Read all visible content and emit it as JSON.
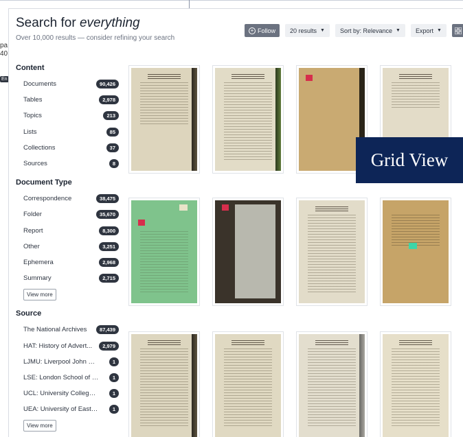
{
  "background": {
    "frag1": "pa",
    "frag2": "40",
    "frag3": "En"
  },
  "header": {
    "title_prefix": "Search for ",
    "title_em": "everything",
    "subtitle": "Over 10,000 results — consider refining your search"
  },
  "toolbar": {
    "follow_label": "Follow",
    "results_label": "20 results",
    "sort_label": "Sort by: Relevance",
    "export_label": "Export",
    "grid_icon": "grid-icon",
    "list_icon": "list-icon"
  },
  "facets": {
    "content": {
      "title": "Content",
      "items": [
        {
          "label": "Documents",
          "count": "90,426"
        },
        {
          "label": "Tables",
          "count": "2,978"
        },
        {
          "label": "Topics",
          "count": "213"
        },
        {
          "label": "Lists",
          "count": "85"
        },
        {
          "label": "Collections",
          "count": "37"
        },
        {
          "label": "Sources",
          "count": "8"
        }
      ]
    },
    "document_type": {
      "title": "Document Type",
      "items": [
        {
          "label": "Correspondence",
          "count": "38,475"
        },
        {
          "label": "Folder",
          "count": "35,670"
        },
        {
          "label": "Report",
          "count": "8,300"
        },
        {
          "label": "Other",
          "count": "3,251"
        },
        {
          "label": "Ephemera",
          "count": "2,968"
        },
        {
          "label": "Summary",
          "count": "2,715"
        }
      ],
      "view_more": "View more"
    },
    "source": {
      "title": "Source",
      "items": [
        {
          "label": "The National Archives",
          "count": "87,439"
        },
        {
          "label": "HAT: History of Advert...",
          "count": "2,979"
        },
        {
          "label": "LJMU: Liverpool John Mo...",
          "count": "1"
        },
        {
          "label": "LSE: London School of Ec...",
          "count": "1"
        },
        {
          "label": "UCL: University College L...",
          "count": "1"
        },
        {
          "label": "UEA: University of East An...",
          "count": "1"
        }
      ],
      "view_more": "View more"
    }
  },
  "tooltip": {
    "label": "Grid View"
  },
  "colors": {
    "badge": "#2f3540",
    "tooltip_bg": "#0d2557",
    "button_dark": "#6b7280"
  }
}
